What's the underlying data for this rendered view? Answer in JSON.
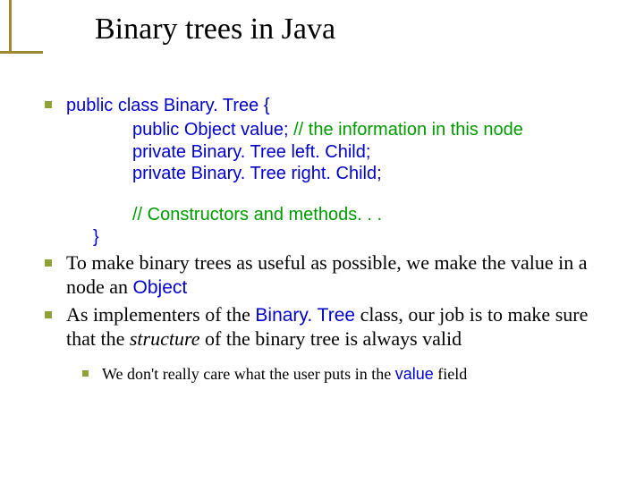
{
  "title": "Binary trees in Java",
  "code": {
    "l1": "public class Binary. Tree {",
    "l2": "public Object value;",
    "c2": " // the information in this node",
    "l3": "private Binary. Tree left. Child;",
    "l4": "private Binary. Tree right. Child;",
    "c5": "// Constructors and methods. . .",
    "l6": "}"
  },
  "pts": {
    "b2a": "To make binary trees as useful as possible, we make the value in a node an ",
    "b2code": "Object",
    "b3a": "As implementers of the ",
    "b3code": "Binary. Tree",
    "b3b": " class, our job is to make sure that the ",
    "b3it": "structure",
    "b3c": " of the binary tree is always valid",
    "sub_a": "We don't really care what the user puts in the ",
    "sub_code": "value",
    "sub_b": " field"
  }
}
